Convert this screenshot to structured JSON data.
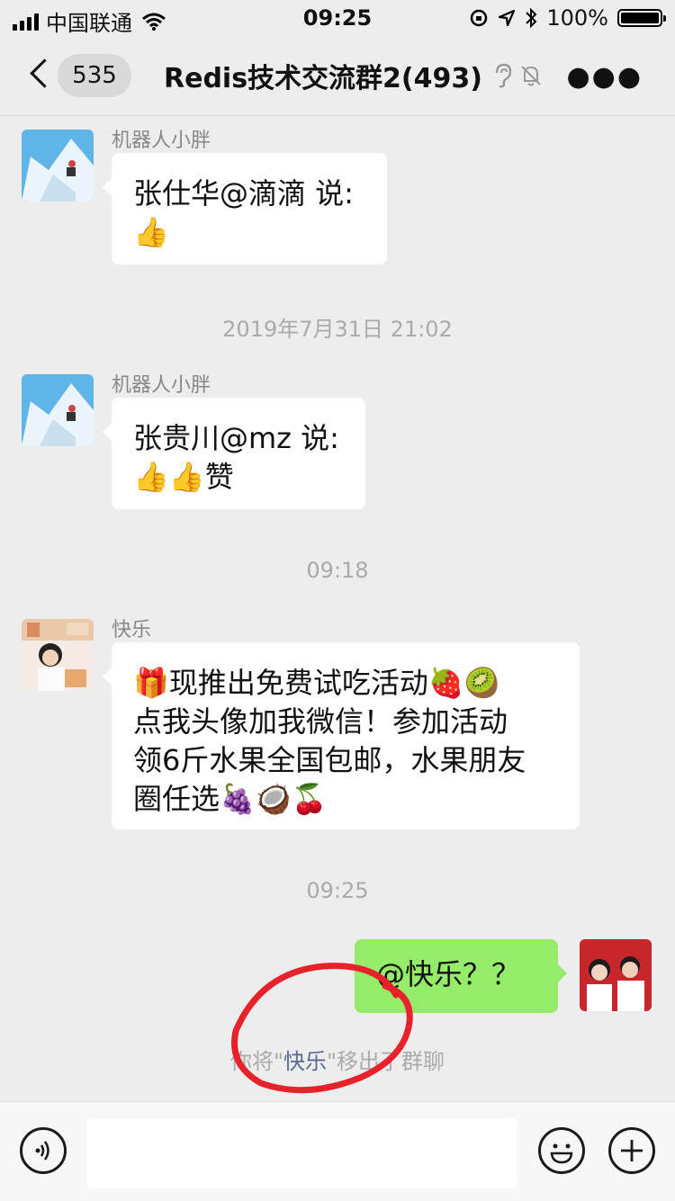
{
  "status_bar": {
    "carrier": "中国联通",
    "time": "09:25",
    "battery": "100%",
    "battery_level": 1.0
  },
  "nav": {
    "unread_count": "535",
    "title": "Redis技术交流群2(493)"
  },
  "messages": [
    {
      "sender": "机器人小胖",
      "lines": [
        "张仕华@滴滴 说:",
        "👍"
      ]
    },
    {
      "sender": "机器人小胖",
      "lines": [
        "张贵川@mz 说:",
        "👍👍赞"
      ]
    },
    {
      "sender": "快乐",
      "lines": [
        "🎁现推出免费试吃活动🍓🥝",
        "点我头像加我微信！参加活动",
        "领6斤水果全国包邮，水果朋友",
        "圈任选🍇🥥🍒"
      ]
    },
    {
      "sender": "me",
      "lines": [
        "@快乐？？"
      ]
    }
  ],
  "timestamps": [
    "2019年7月31日 21:02",
    "09:18",
    "09:25"
  ],
  "system_notice": {
    "prefix": "你将\"",
    "name": "快乐",
    "suffix": "\"移出了群聊"
  },
  "colors": {
    "bubble_mine": "#95ec69",
    "link": "#576b95",
    "annotation": "#e8222a"
  }
}
